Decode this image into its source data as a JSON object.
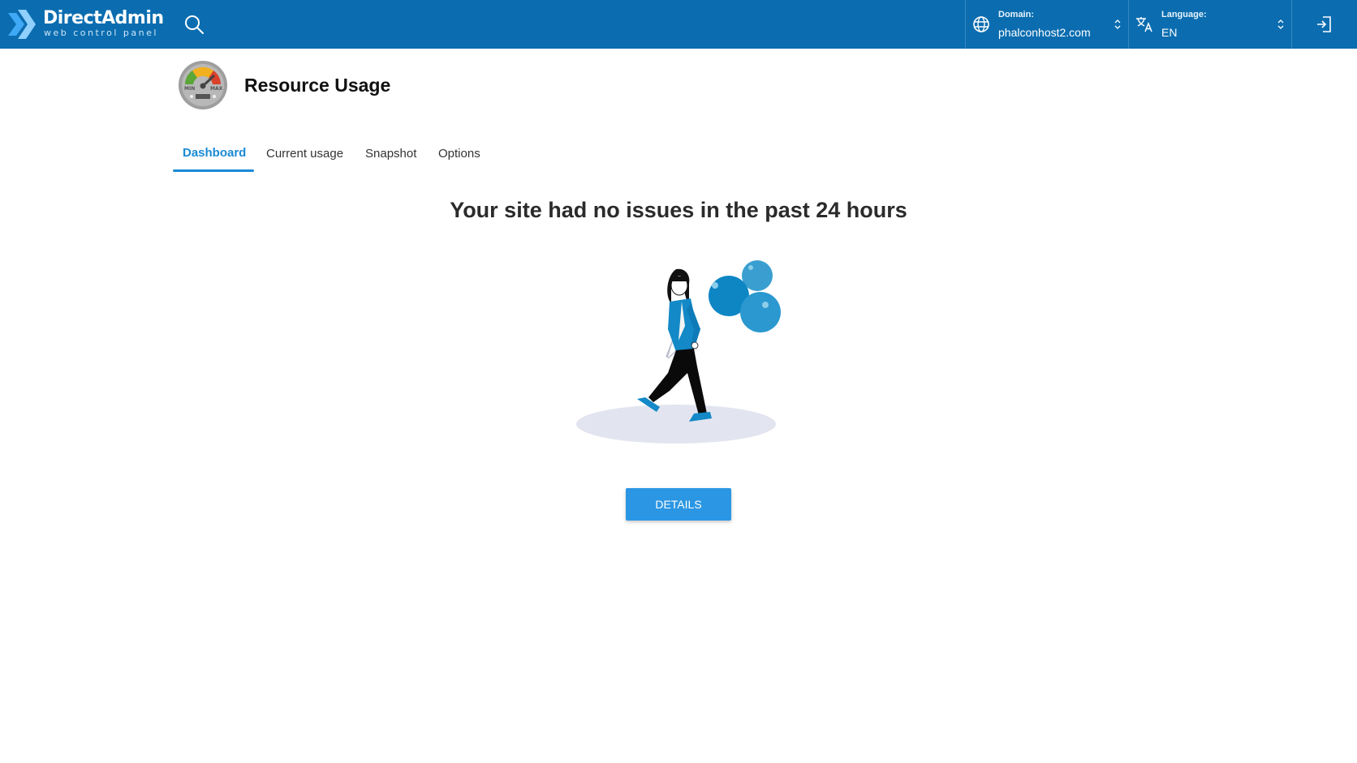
{
  "header": {
    "logo_title": "DirectAdmin",
    "logo_subtitle": "web control panel",
    "search_icon": "search-icon",
    "domain_label": "Domain:",
    "domain_value": "phalconhost2.com",
    "language_label": "Language:",
    "language_value": "EN",
    "logout_icon": "logout-icon"
  },
  "page": {
    "title": "Resource Usage",
    "icon": "gauge-icon",
    "gauge_labels": {
      "min": "MIN",
      "max": "MAX"
    }
  },
  "tabs": [
    {
      "label": "Dashboard",
      "active": true
    },
    {
      "label": "Current usage",
      "active": false
    },
    {
      "label": "Snapshot",
      "active": false
    },
    {
      "label": "Options",
      "active": false
    }
  ],
  "content": {
    "headline": "Your site had no issues in the past 24 hours",
    "illustration": "woman-with-balloons",
    "details_button": "DETAILS"
  },
  "colors": {
    "header_bg": "#0b6db0",
    "accent": "#1a8ad6",
    "button_bg": "#2b96e3"
  }
}
